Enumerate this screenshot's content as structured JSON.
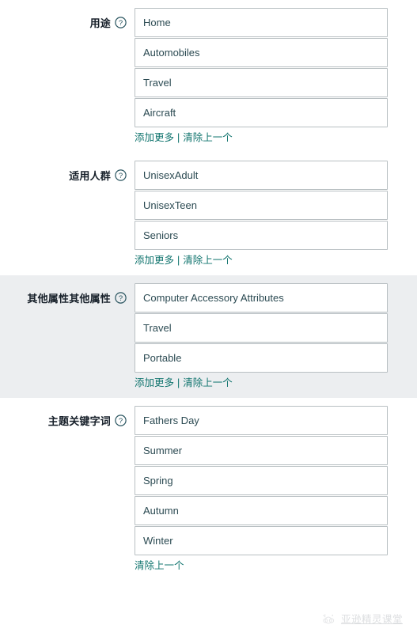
{
  "page": {
    "background": "#ffffff",
    "shaded_background": "#eceef0",
    "link_color": "#12756f",
    "field_text_color": "#2b4a52",
    "label_color": "#17202a",
    "field_border_color": "#b8bfc2"
  },
  "common": {
    "help_icon": "question-circle-icon",
    "add_more_label": "添加更多",
    "clear_last_label": "清除上一个",
    "separator": "|"
  },
  "sections": [
    {
      "id": "usage",
      "label": "用途",
      "shaded": false,
      "fields": [
        "Home",
        "Automobiles",
        "Travel",
        "Aircraft"
      ],
      "has_add_more": true,
      "has_clear_last": true
    },
    {
      "id": "target-audience",
      "label": "适用人群",
      "shaded": false,
      "fields": [
        "UnisexAdult",
        "UnisexTeen",
        "Seniors"
      ],
      "has_add_more": true,
      "has_clear_last": true
    },
    {
      "id": "other-attributes",
      "label": "其他属性其他属性",
      "shaded": true,
      "fields": [
        "Computer Accessory Attributes",
        "Travel",
        "Portable"
      ],
      "has_add_more": true,
      "has_clear_last": true
    },
    {
      "id": "subject-keywords",
      "label": "主题关键字词",
      "shaded": false,
      "fields": [
        "Fathers Day",
        "Summer",
        "Spring",
        "Autumn",
        "Winter"
      ],
      "has_add_more": false,
      "has_clear_last": true
    }
  ],
  "watermark": {
    "text": "亚逊精灵课堂",
    "icon": "cloud-sparkle-icon"
  }
}
